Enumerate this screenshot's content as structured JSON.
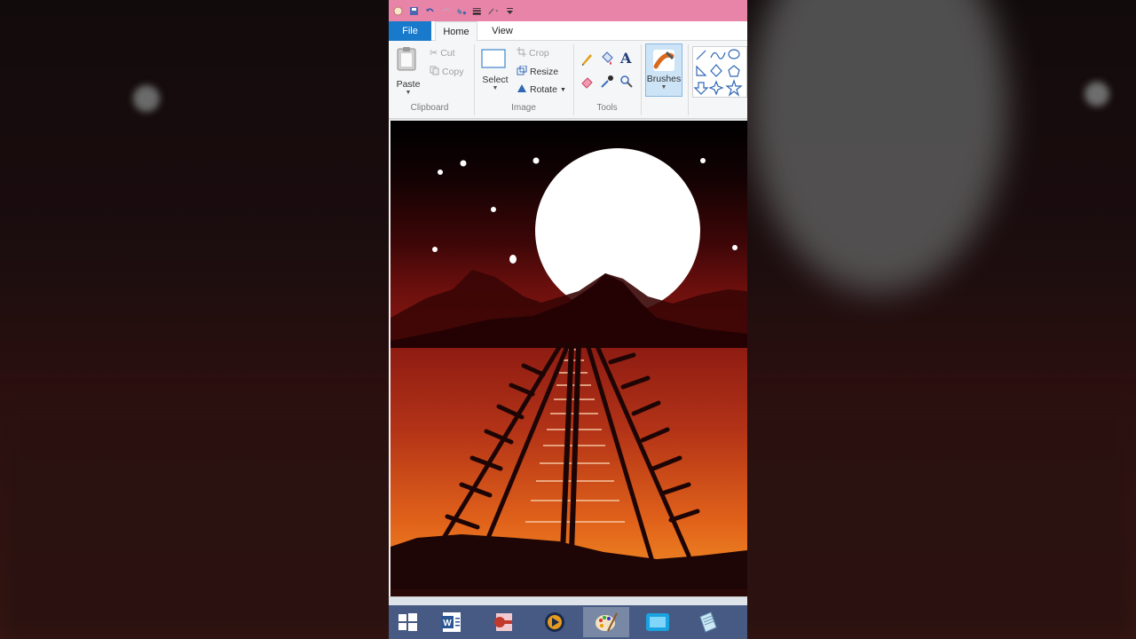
{
  "menu": {
    "file": "File",
    "tabs": [
      "Home",
      "View"
    ]
  },
  "clipboard": {
    "paste": "Paste",
    "cut": "Cut",
    "copy": "Copy",
    "label": "Clipboard"
  },
  "image": {
    "select": "Select",
    "crop": "Crop",
    "resize": "Resize",
    "rotate": "Rotate",
    "label": "Image"
  },
  "tools": {
    "label": "Tools",
    "text_glyph": "A"
  },
  "brushes": {
    "label": "Brushes"
  },
  "taskbar": {
    "items": [
      "start-button",
      "word",
      "powerpoint",
      "media",
      "paint",
      "snipping",
      "notes"
    ]
  },
  "colors": {
    "title_bar": "#e884a7",
    "file_tab": "#1979ca",
    "taskbar": "#465a83"
  }
}
